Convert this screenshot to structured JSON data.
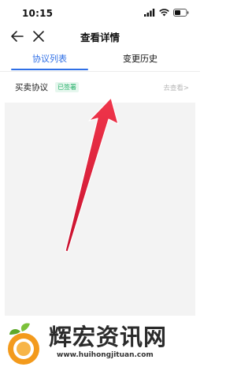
{
  "status_bar": {
    "time": "10:15"
  },
  "nav": {
    "title": "查看详情",
    "back_icon": "arrow-left-icon",
    "close_icon": "close-icon"
  },
  "tabs": [
    {
      "label": "协议列表",
      "active": true
    },
    {
      "label": "变更历史",
      "active": false
    }
  ],
  "agreement": {
    "title": "买卖协议",
    "status": "已签署",
    "action": "去查看>"
  },
  "colors": {
    "accent": "#2f6fe6",
    "badge_text": "#27b06a",
    "arrow": "#e8293f"
  },
  "watermark": {
    "main": "辉宏资讯网",
    "url": "www.huihongjituan.com"
  }
}
